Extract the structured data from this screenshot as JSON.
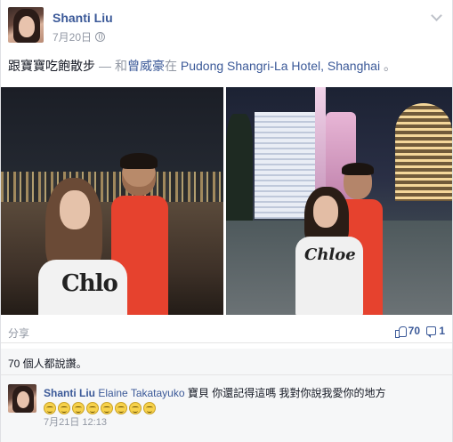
{
  "post": {
    "author": "Shanti Liu",
    "date": "7月20日",
    "privacy_icon": "globe-icon",
    "status": {
      "text": "跟寶寶吃飽散步",
      "dash": "—",
      "with_prefix": "和",
      "with_name": "曾威豪",
      "at_prefix": "在",
      "place": "Pudong Shangri-La Hotel, Shanghai",
      "suffix": "。"
    },
    "photos": {
      "left": {
        "shirt_text": "Chlo"
      },
      "right": {
        "shirt_text": "Chloe"
      }
    }
  },
  "actions": {
    "share_label": "分享",
    "like_count": "70",
    "comment_count": "1"
  },
  "likes_summary": "70 個人都說讚。",
  "comment": {
    "author": "Shanti Liu",
    "tagged": "Elaine Takatayuko",
    "text": "寶貝 你還記得這嗎 我對你說我愛你的地方",
    "emoji_count": 8,
    "timestamp": "7月21日 12:13"
  }
}
